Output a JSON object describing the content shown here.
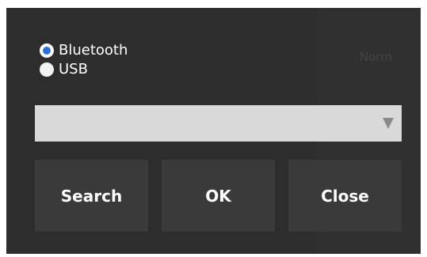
{
  "connection": {
    "options": [
      {
        "label": "Bluetooth",
        "selected": true
      },
      {
        "label": "USB",
        "selected": false
      }
    ]
  },
  "device_select": {
    "value": "",
    "arrow_icon": "dropdown-arrow-icon"
  },
  "background": {
    "partial_text": "Norm"
  },
  "buttons": {
    "search_label": "Search",
    "ok_label": "OK",
    "close_label": "Close"
  },
  "colors": {
    "window_bg": "#2d2d2d",
    "button_bg": "#3a3a3a",
    "radio_accent": "#2f6fd4",
    "dropdown_bg": "#d9d9d9"
  }
}
